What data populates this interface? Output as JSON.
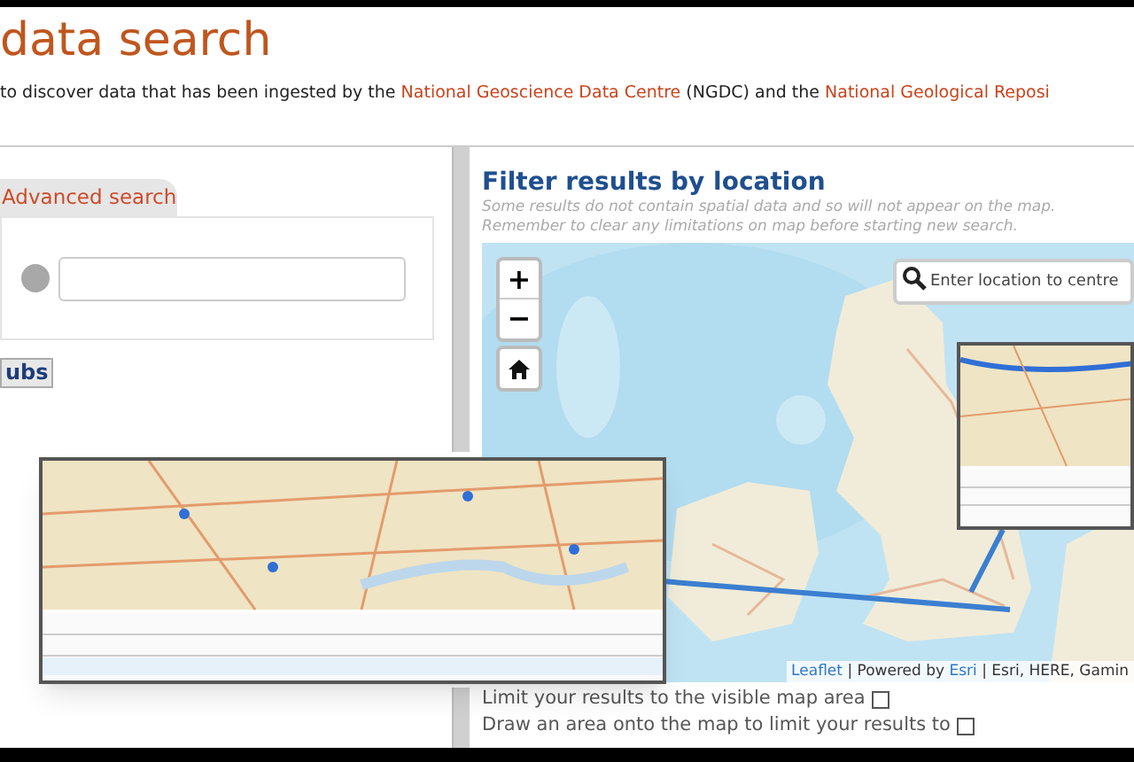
{
  "header": {
    "title": "data search",
    "intro": [
      {
        "text": "to discover data that has been ingested by the ",
        "link": false
      },
      {
        "text": "National Geoscience Data Centre",
        "link": true
      },
      {
        "text": " (NGDC) and the ",
        "link": false
      },
      {
        "text": "National Geological Reposi",
        "link": true
      }
    ]
  },
  "left_panel": {
    "tabs": [
      {
        "label": "Advanced search",
        "selected": true
      }
    ],
    "button": "ubs"
  },
  "filter": {
    "heading": "Filter results by location",
    "notes": [
      "Some results do not contain spatial data and so will not appear on the map.",
      "Remember to clear any limitations on map before starting new search."
    ],
    "map": {
      "zoom_in": "+",
      "zoom_out": "−",
      "search_placeholder": "Enter location to centre",
      "attribution": [
        {
          "text": "Leaflet",
          "link": true
        },
        {
          "text": " | Powered by ",
          "link": false
        },
        {
          "text": "Esri",
          "link": true
        },
        {
          "text": " | Esri, HERE, Gamin",
          "link": false
        }
      ]
    },
    "options": [
      {
        "label": "Limit your results to the visible map area",
        "checked": false
      },
      {
        "label": "Draw an area onto the map to limit your results to",
        "checked": false
      }
    ]
  }
}
